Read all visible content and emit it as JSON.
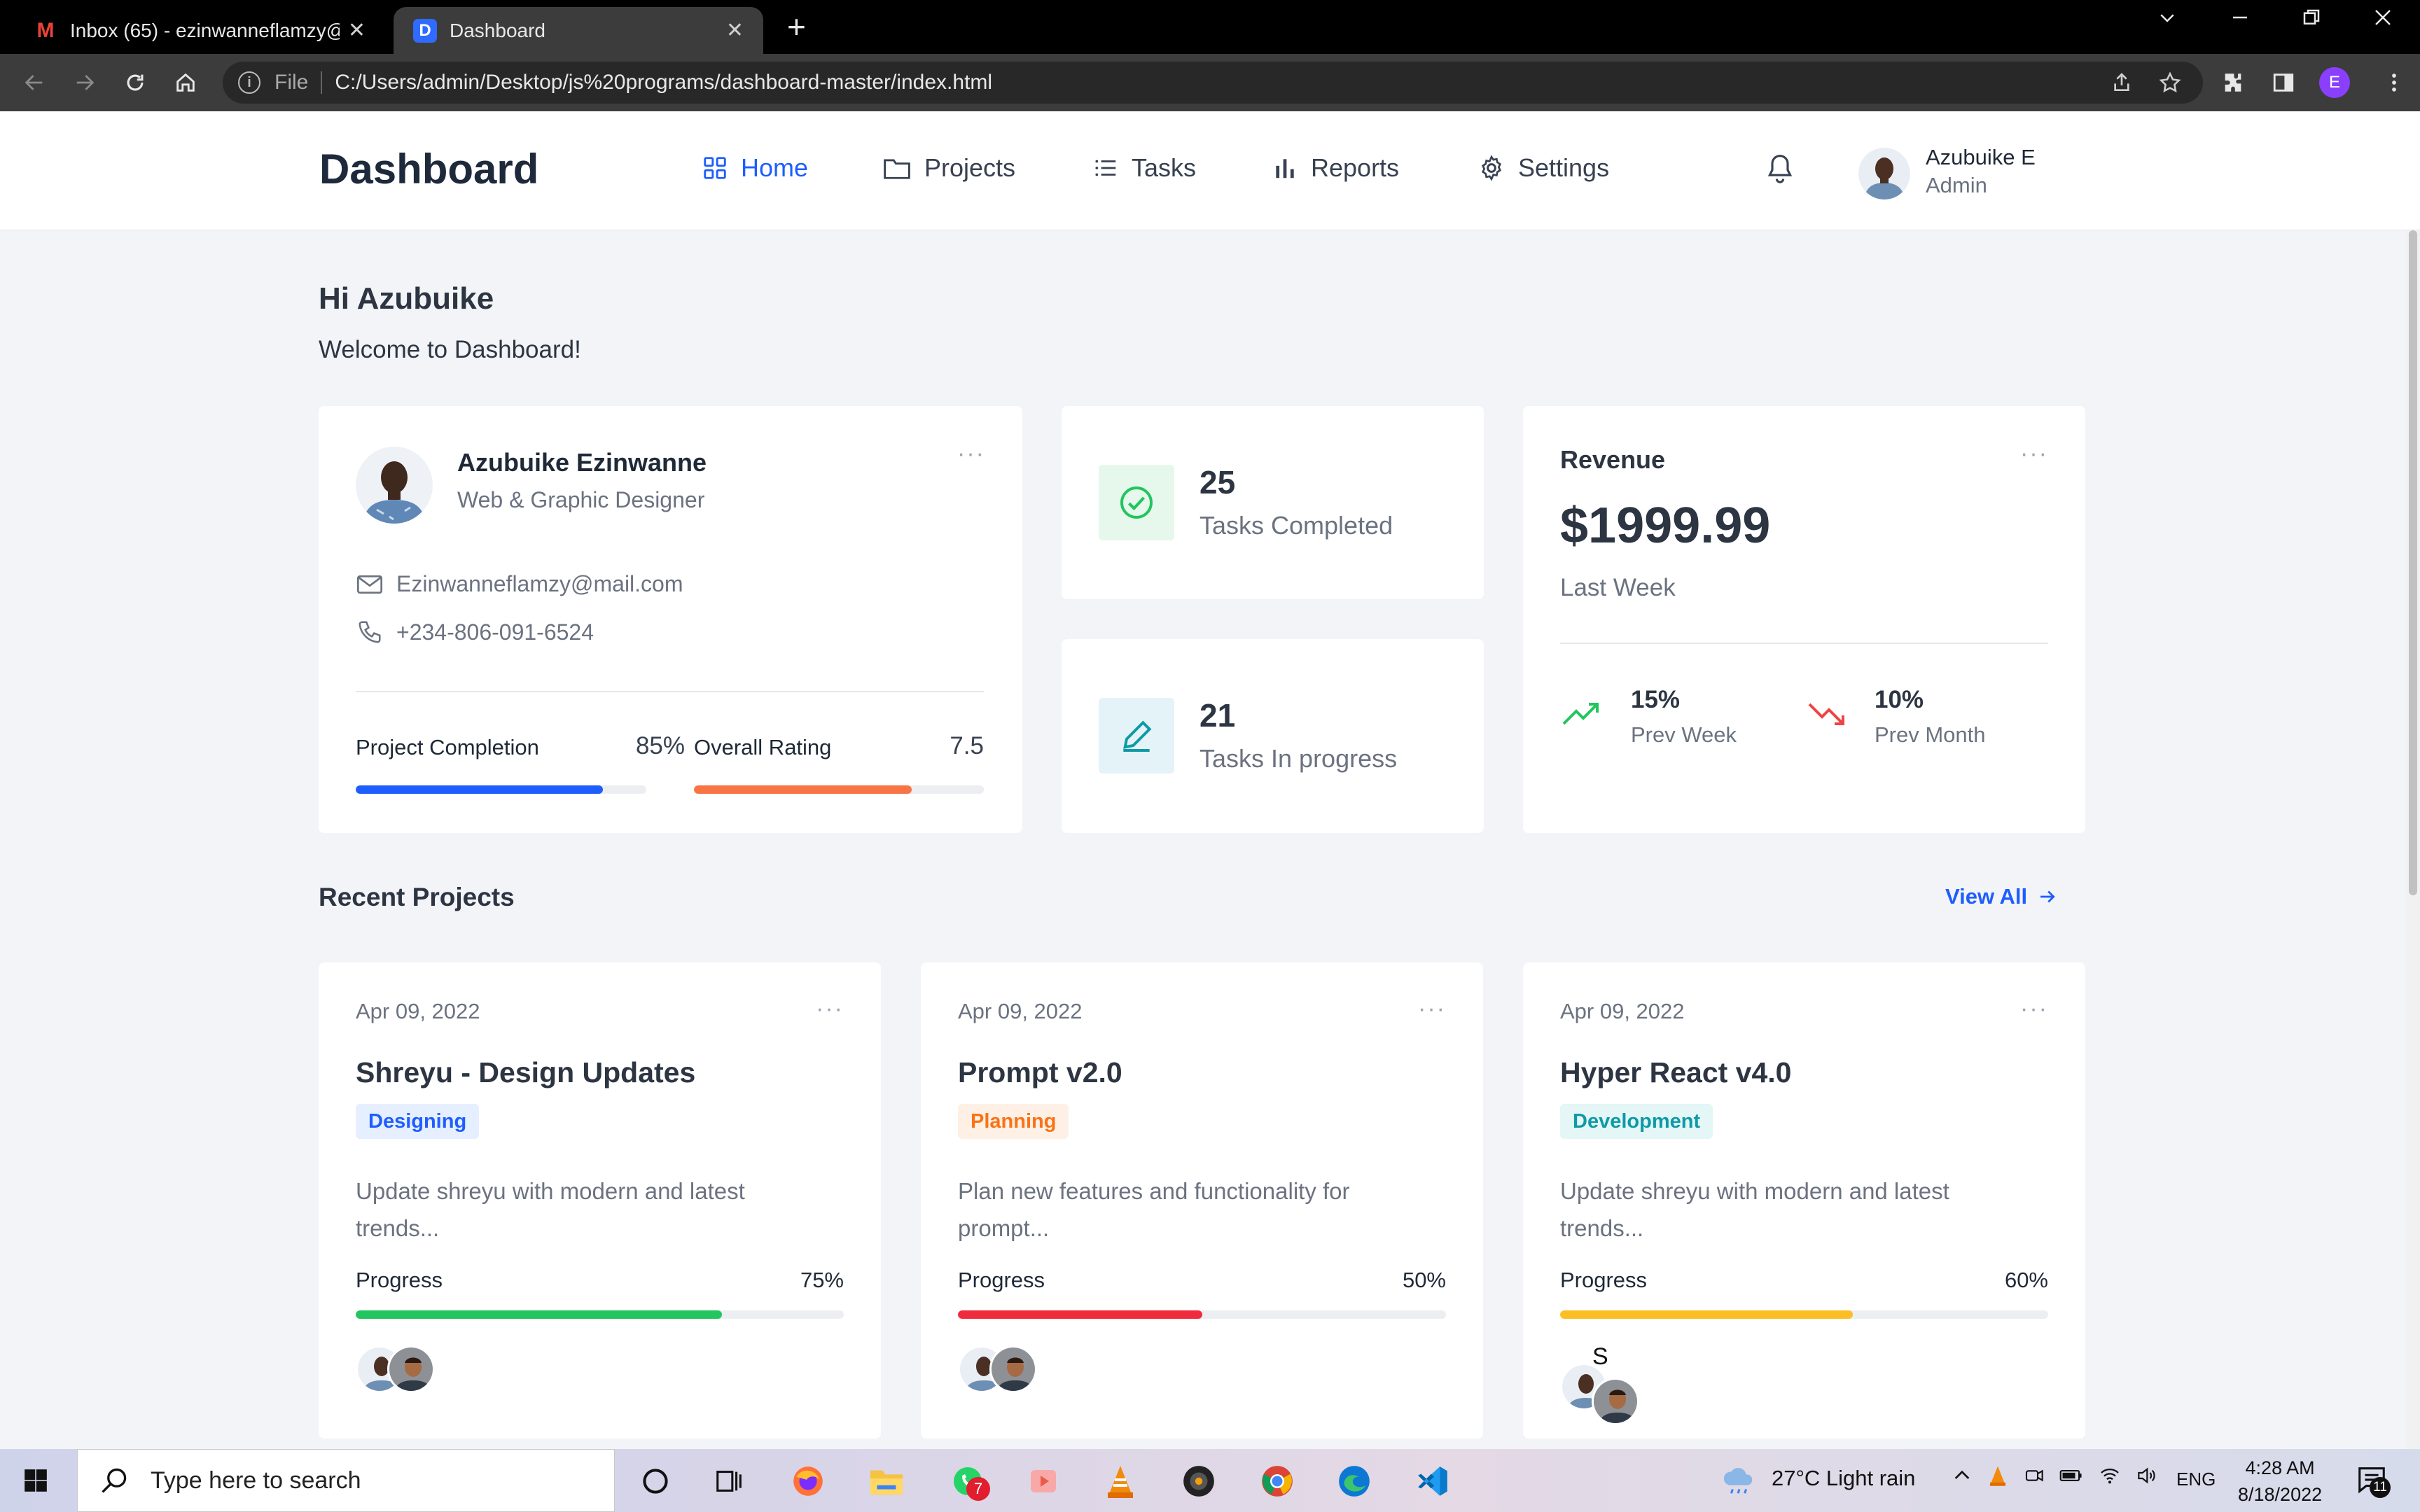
{
  "browser": {
    "tabs": [
      {
        "title": "Inbox (65) - ezinwanneflamzy@g",
        "icon": "gmail-icon",
        "active": false
      },
      {
        "title": "Dashboard",
        "icon": "d-favicon",
        "active": true
      }
    ],
    "address_scheme": "File",
    "address": "C:/Users/admin/Desktop/js%20programs/dashboard-master/index.html",
    "profile_initial": "E"
  },
  "header": {
    "brand": "Dashboard",
    "nav": [
      {
        "label": "Home",
        "icon": "grid-icon",
        "active": true
      },
      {
        "label": "Projects",
        "icon": "folder-icon",
        "active": false
      },
      {
        "label": "Tasks",
        "icon": "list-icon",
        "active": false
      },
      {
        "label": "Reports",
        "icon": "bar-chart-icon",
        "active": false
      },
      {
        "label": "Settings",
        "icon": "gear-icon",
        "active": false
      }
    ],
    "user_name": "Azubuike E",
    "user_role": "Admin"
  },
  "greeting": {
    "title": "Hi Azubuike",
    "subtitle": "Welcome to Dashboard!"
  },
  "profile_card": {
    "name": "Azubuike Ezinwanne",
    "title": "Web & Graphic Designer",
    "email": "Ezinwanneflamzy@mail.com",
    "phone": "+234-806-091-6524",
    "project_completion_label": "Project Completion",
    "project_completion_value": "85%",
    "project_completion_fraction": 0.85,
    "rating_label": "Overall Rating",
    "rating_value": "7.5",
    "rating_fraction": 0.75
  },
  "stats": [
    {
      "number": "25",
      "label": "Tasks Completed",
      "icon": "check-circle-icon"
    },
    {
      "number": "21",
      "label": "Tasks In progress",
      "icon": "pencil-icon"
    }
  ],
  "revenue": {
    "title": "Revenue",
    "amount": "$1999.99",
    "period": "Last Week",
    "items": [
      {
        "pct": "15%",
        "label": "Prev Week",
        "trend": "up",
        "color": "#22c55e"
      },
      {
        "pct": "10%",
        "label": "Prev Month",
        "trend": "down",
        "color": "#ef4444"
      }
    ]
  },
  "recent": {
    "title": "Recent Projects",
    "view_all": "View All",
    "projects": [
      {
        "date": "Apr 09, 2022",
        "name": "Shreyu - Design Updates",
        "tag": "Designing",
        "tag_color": "#1e5eff",
        "tag_bg": "#e6efff",
        "desc": "Update shreyu with modern and latest trends...",
        "progress_label": "Progress",
        "progress_value": "75%",
        "progress_fraction": 0.75,
        "bar_color": "#22c55e"
      },
      {
        "date": "Apr 09, 2022",
        "name": "Prompt v2.0",
        "tag": "Planning",
        "tag_color": "#f97316",
        "tag_bg": "#fff0e6",
        "desc": "Plan new features and functionality for prompt...",
        "progress_label": "Progress",
        "progress_value": "50%",
        "progress_fraction": 0.5,
        "bar_color": "#ef2b3c"
      },
      {
        "date": "Apr 09, 2022",
        "name": "Hyper React v4.0",
        "tag": "Development",
        "tag_color": "#0e9aa7",
        "tag_bg": "#e4f6f6",
        "desc": "Update shreyu with modern and latest trends...",
        "progress_label": "Progress",
        "progress_value": "60%",
        "progress_fraction": 0.6,
        "bar_color": "#fbbf24",
        "avatar_letter": "S"
      }
    ]
  },
  "taskbar": {
    "search_placeholder": "Type here to search",
    "weather": "27°C  Light rain",
    "language": "ENG",
    "time": "4:28 AM",
    "date": "8/18/2022",
    "notification_count": "11",
    "whatsapp_badge": "7"
  }
}
